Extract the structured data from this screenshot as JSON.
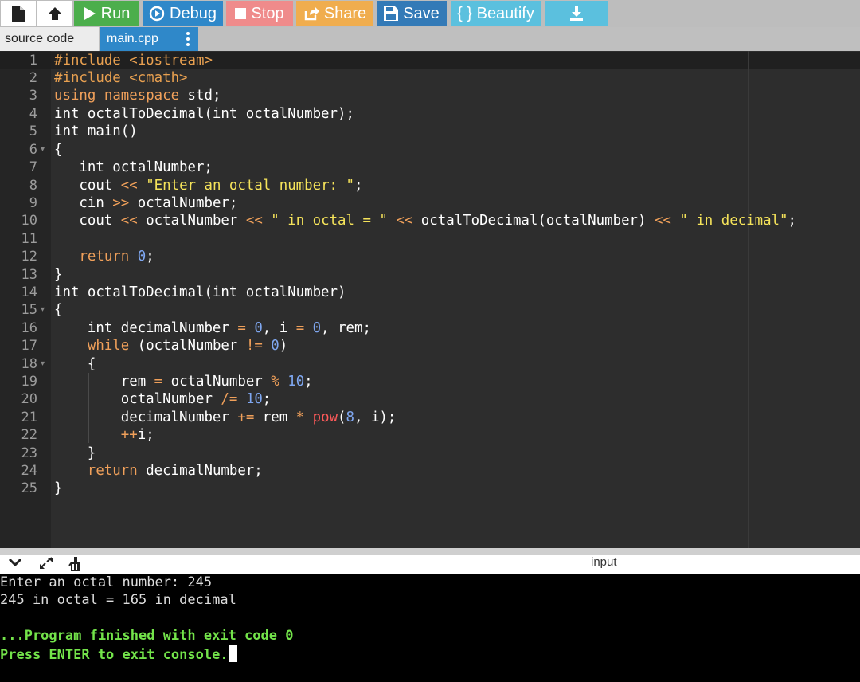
{
  "toolbar": {
    "run_label": "Run",
    "debug_label": "Debug",
    "stop_label": "Stop",
    "share_label": "Share",
    "save_label": "Save",
    "beautify_label": "{ } Beautify"
  },
  "tabs": {
    "source_label": "source code",
    "file_label": "main.cpp"
  },
  "editor": {
    "line_numbers": [
      "1",
      "2",
      "3",
      "4",
      "5",
      "6",
      "7",
      "8",
      "9",
      "10",
      "11",
      "12",
      "13",
      "14",
      "15",
      "16",
      "17",
      "18",
      "19",
      "20",
      "21",
      "22",
      "23",
      "24",
      "25"
    ],
    "language": "C++",
    "active_line": 1
  },
  "console": {
    "input_label": "input",
    "lines": [
      "Enter an octal number: 245",
      "245 in octal = 165 in decimal",
      "",
      "...Program finished with exit code 0",
      "Press ENTER to exit console."
    ]
  },
  "colors": {
    "run": "#4cae4c",
    "debug": "#2f88c9",
    "stop": "#ef8b8b",
    "share": "#f0ad4e",
    "save": "#337ab7",
    "beautify": "#5bc0de",
    "console_finish": "#73e34a"
  },
  "icons": {
    "new_file": "file-icon",
    "upload": "upload-icon",
    "run": "play-icon",
    "debug": "debug-circle-icon",
    "stop": "stop-square-icon",
    "share": "share-icon",
    "save": "floppy-disk-icon",
    "download": "download-icon",
    "tab_menu": "vertical-dots-icon",
    "collapse": "chevron-down-icon",
    "expand": "expand-arrows-icon",
    "clear": "clear-console-icon"
  }
}
